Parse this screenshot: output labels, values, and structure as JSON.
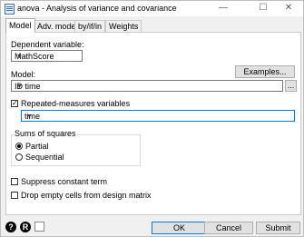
{
  "window": {
    "title": "anova - Analysis of variance and covariance"
  },
  "titlebar": {
    "minimize": "—",
    "maximize": "☐",
    "close": "✕"
  },
  "tabs": [
    {
      "label": "Model",
      "active": true
    },
    {
      "label": "Adv. model",
      "active": false
    },
    {
      "label": "by/if/in",
      "active": false
    },
    {
      "label": "Weights",
      "active": false
    }
  ],
  "model": {
    "dependent_label": "Dependent variable:",
    "dependent_value": "MathScore",
    "model_label": "Model:",
    "examples_button": "Examples...",
    "model_value": "ID time",
    "browse_button": "...",
    "repeated_label": "Repeated-measures variables",
    "repeated_checked": true,
    "repeated_value": "time",
    "sums_title": "Sums of squares",
    "partial_label": "Partial",
    "sequential_label": "Sequential",
    "sums_selected": "Partial",
    "suppress_label": "Suppress constant term",
    "suppress_checked": false,
    "drop_label": "Drop empty cells from design matrix",
    "drop_checked": false
  },
  "footer": {
    "help_icon": "?",
    "reset_icon": "R",
    "ok_button": "OK",
    "cancel_button": "Cancel",
    "submit_button": "Submit"
  },
  "colors": {
    "accent": "#0078d7",
    "panel": "#ffffff",
    "chrome": "#f0f0f0"
  }
}
